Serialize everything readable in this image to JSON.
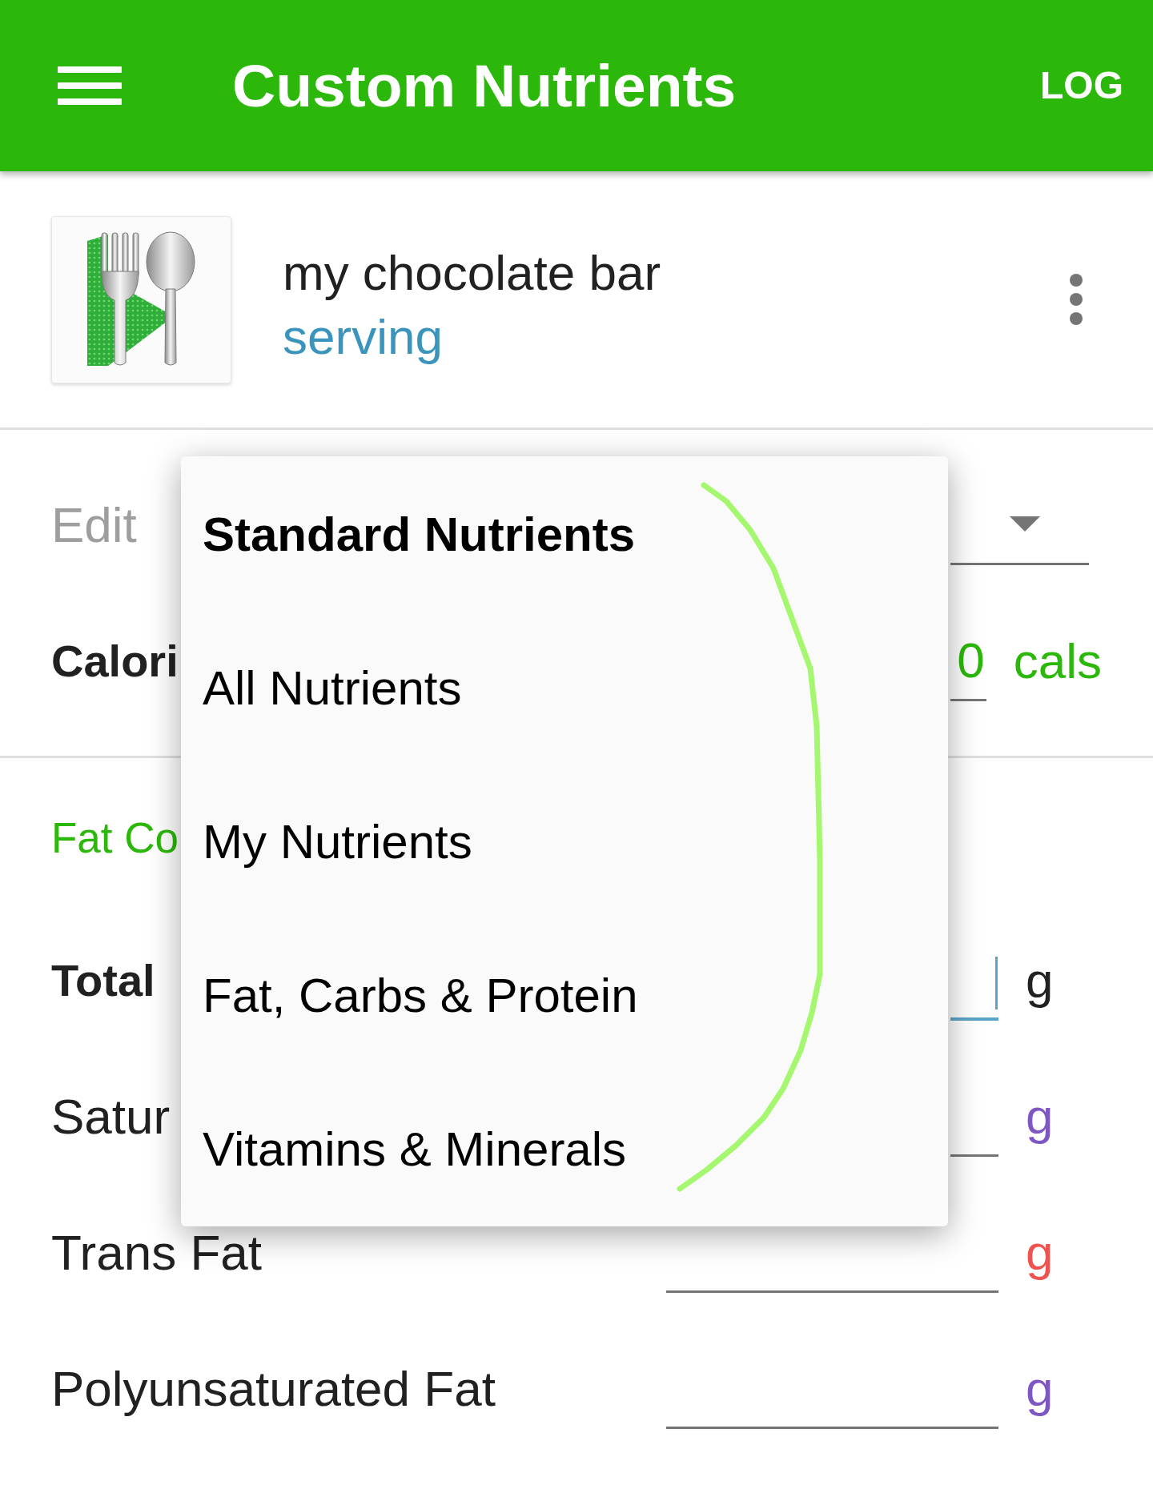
{
  "app_bar": {
    "title": "Custom Nutrients",
    "action": "LOG"
  },
  "food": {
    "name": "my chocolate bar",
    "serving": "serving"
  },
  "edit": {
    "label": "Edit"
  },
  "calories": {
    "label": "Calori",
    "value": "0",
    "unit": "cals"
  },
  "section": {
    "title": "Fat Co"
  },
  "rows": [
    {
      "kind": "total",
      "label": "Total",
      "focused": true,
      "unit": "g",
      "color": "#212121"
    },
    {
      "kind": "sub",
      "label": "Satur",
      "focused": false,
      "unit": "g",
      "color": "#7e57c2"
    },
    {
      "kind": "sub",
      "label": "Trans Fat",
      "focused": false,
      "unit": "g",
      "color": "#ef5350"
    },
    {
      "kind": "sub",
      "label": "Polyunsaturated Fat",
      "focused": false,
      "unit": "g",
      "color": "#7e57c2"
    }
  ],
  "dropdown_menu": {
    "items": [
      {
        "label": "Standard Nutrients",
        "selected": true
      },
      {
        "label": "All Nutrients",
        "selected": false
      },
      {
        "label": "My Nutrients",
        "selected": false
      },
      {
        "label": "Fat, Carbs & Protein",
        "selected": false
      },
      {
        "label": "Vitamins & Minerals",
        "selected": false
      }
    ]
  }
}
